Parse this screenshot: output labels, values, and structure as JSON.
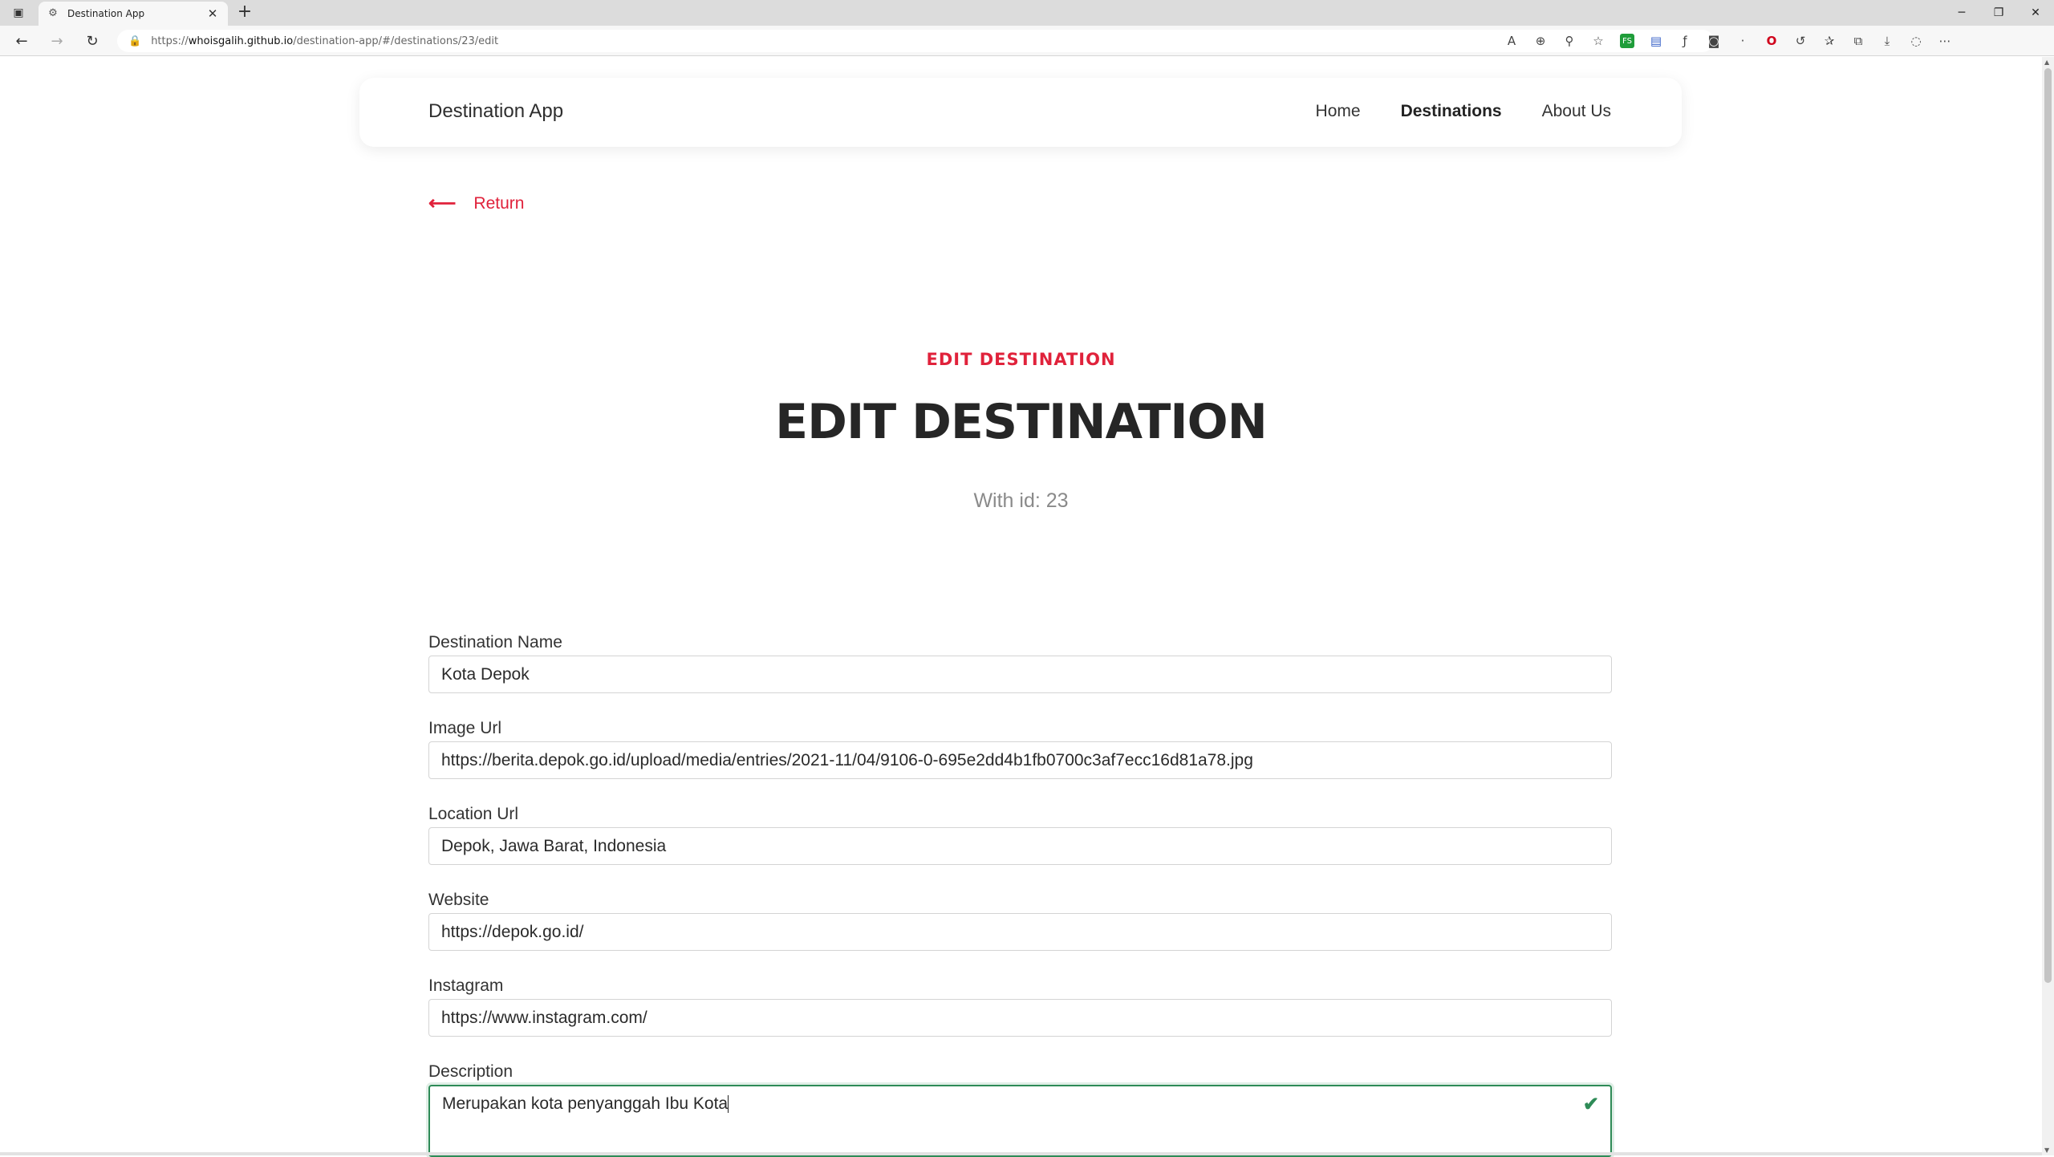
{
  "browser": {
    "tab_title": "Destination App",
    "url_prefix": "https://",
    "url_host": "whoisgalih.github.io",
    "url_path": "/destination-app/#/destinations/23/edit",
    "ext_badge": "FS"
  },
  "navbar": {
    "brand": "Destination App",
    "links": [
      "Home",
      "Destinations",
      "About Us"
    ]
  },
  "return_link": {
    "label": "Return"
  },
  "hero": {
    "eyebrow": "EDIT DESTINATION",
    "title": "EDIT DESTINATION",
    "subtitle": "With id: 23"
  },
  "form": {
    "fields": [
      {
        "label": "Destination Name",
        "value": "Kota Depok"
      },
      {
        "label": "Image Url",
        "value": "https://berita.depok.go.id/upload/media/entries/2021-11/04/9106-0-695e2dd4b1fb0700c3af7ecc16d81a78.jpg"
      },
      {
        "label": "Location Url",
        "value": "Depok, Jawa Barat, Indonesia"
      },
      {
        "label": "Website",
        "value": "https://depok.go.id/"
      },
      {
        "label": "Instagram",
        "value": "https://www.instagram.com/"
      }
    ],
    "description": {
      "label": "Description",
      "value": "Merupakan kota penyanggah Ibu Kota"
    }
  },
  "colors": {
    "accent": "#e0223b",
    "valid": "#2e8b57"
  }
}
